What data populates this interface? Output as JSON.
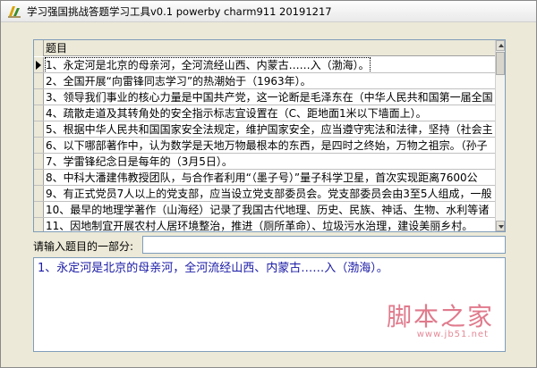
{
  "window": {
    "title": "学习强国挑战答题学习工具v0.1 powerby charm911 20191217"
  },
  "grid": {
    "column_header": "题目",
    "rows": [
      "1、永定河是北京的母亲河，全河流经山西、内蒙古……入（渤海）。",
      "2、全国开展“向雷锋同志学习”的热潮始于（1963年）。",
      "3、领导我们事业的核心力量是中国共产党，这一论断是毛泽东在（中华人民共和国第一届全国",
      "4、疏散走道及其转角处的安全指示标志宜设置在（C、距地面1米以下墙面上）。",
      "5、根据中华人民共和国国家安全法规定，维护国家安全，应当遵守宪法和法律，坚持（社会主",
      "6、以下哪部著作中，认为数学是天地万物最根本的东西，是四时之终始，万物之祖宗。（孙子",
      "7、学雷锋纪念日是每年的（3月5日）。",
      "8、中科大潘建伟教授团队，与合作者利用“（墨子号）”量子科学卫星，首次实现距离7600公",
      "9、有正式党员7人以上的党支部，应当设立党支部委员会。党支部委员会由3至5人组成，一般",
      "10、最早的地理学著作（山海经）记录了我国古代地理、历史、民族、神话、生物、水利等诸",
      "11、因地制宜开展农村人居环境整治，推进（厕所革命）、垃圾污水治理，建设美丽乡村。"
    ]
  },
  "search": {
    "label": "请输入题目的一部分:",
    "value": "",
    "placeholder": ""
  },
  "result": {
    "text": "1、永定河是北京的母亲河，全河流经山西、内蒙古……入（渤海）。"
  },
  "watermark": {
    "brand": "脚本之家",
    "url": "www.jb51.net"
  },
  "colors": {
    "result_text": "#1a1aa6",
    "watermark": "#e07a8c"
  }
}
